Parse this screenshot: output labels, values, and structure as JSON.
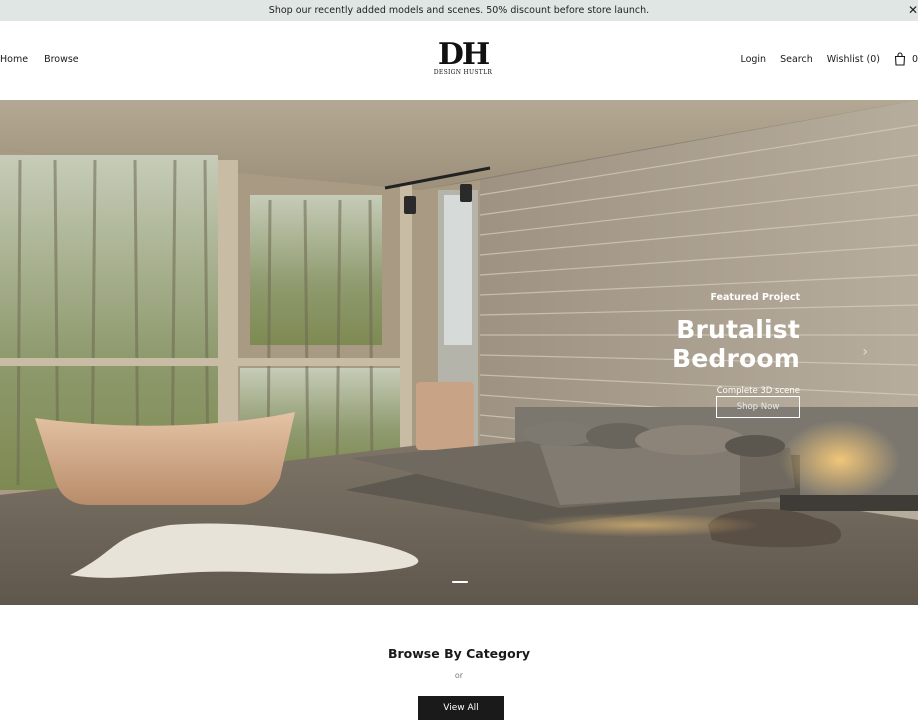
{
  "announcement": {
    "text": "Shop our recently added models and scenes. 50% discount before store launch.",
    "close_icon": "close-icon"
  },
  "header": {
    "nav_left": [
      "Home",
      "Browse"
    ],
    "logo": {
      "mark": "DH",
      "wordmark": "DESIGN HUSTLR"
    },
    "nav_right": {
      "login": "Login",
      "search": "Search",
      "wishlist": "Wishlist (0)",
      "cart_count": "0",
      "cart_icon": "shopping-bag-icon"
    }
  },
  "hero": {
    "eyebrow": "Featured Project",
    "title": "Brutalist Bedroom",
    "subtitle": "Complete 3D scene",
    "button": "Shop Now",
    "slides": 1,
    "next_icon": "chevron-right-icon"
  },
  "categories": {
    "title": "Browse By Category",
    "or_text": "or",
    "view_all": "View All"
  },
  "colors": {
    "announcement_bg": "#dfe6e3",
    "button_bg": "#1a1a1a",
    "text": "#1a1a1a"
  }
}
